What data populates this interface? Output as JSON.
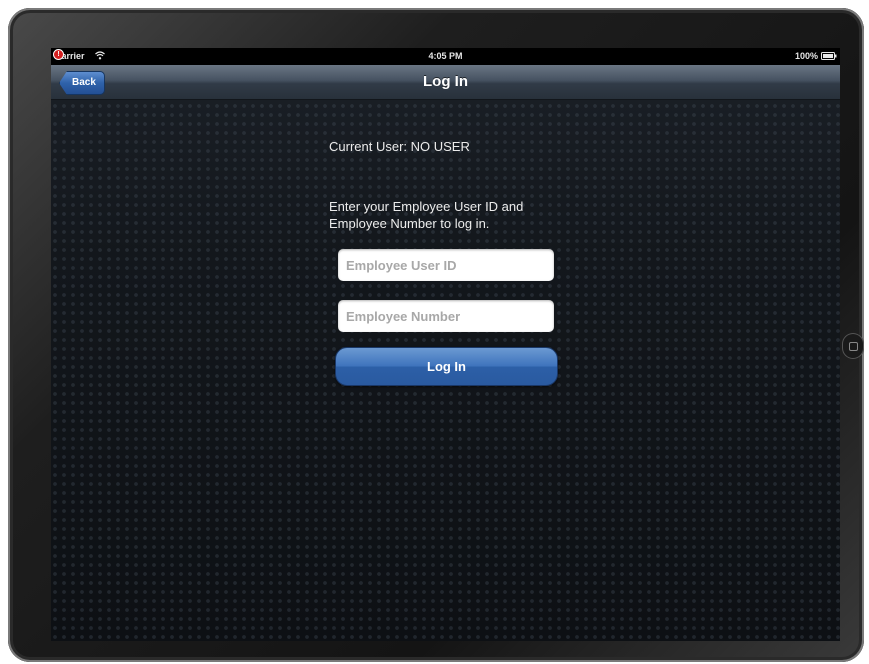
{
  "status_bar": {
    "carrier": "Carrier",
    "time": "4:05 PM",
    "battery": "100%"
  },
  "nav": {
    "title": "Log In",
    "back_label": "Back",
    "alert_badge": "!"
  },
  "login": {
    "current_user": "Current User: NO USER",
    "instructions": "Enter your Employee User ID and Employee Number to log in.",
    "user_id_placeholder": "Employee User ID",
    "user_id_value": "",
    "employee_number_placeholder": "Employee Number",
    "employee_number_value": "",
    "button_label": "Log In"
  },
  "icons": {
    "wifi": "wifi-icon",
    "battery": "battery-icon",
    "home": "home-button-icon"
  },
  "colors": {
    "nav_bar": "#3a4552",
    "button_blue": "#3f74bd",
    "background": "#13171c",
    "alert_red": "#d42020"
  }
}
